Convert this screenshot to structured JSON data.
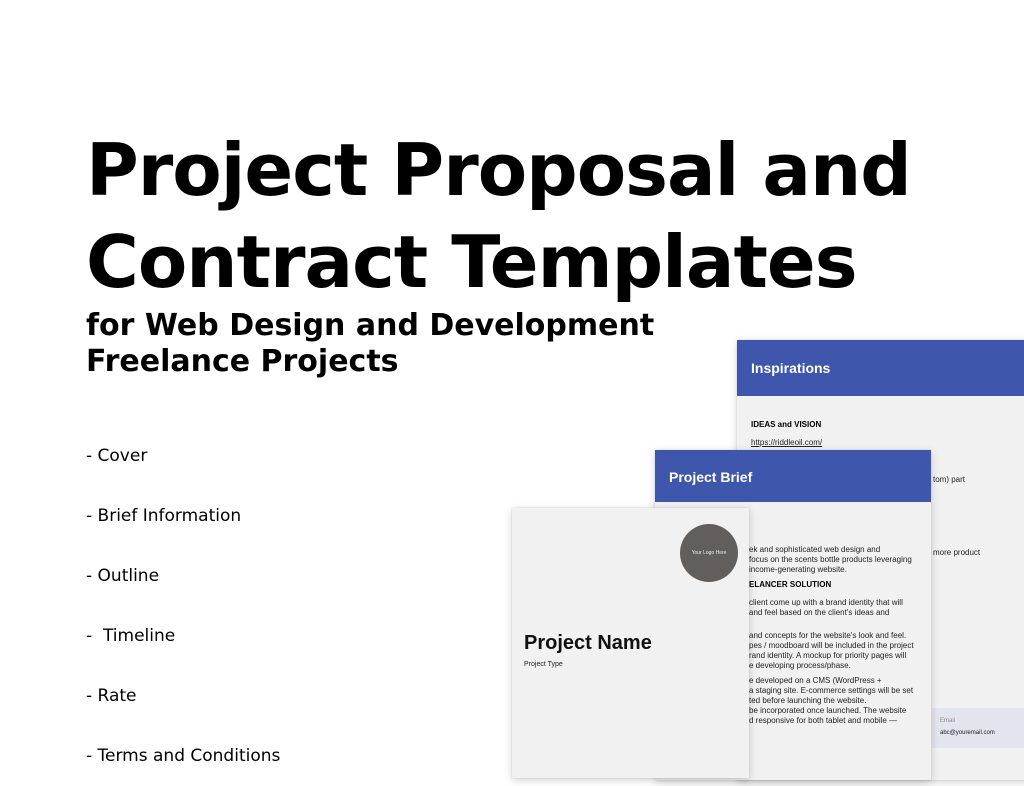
{
  "title": {
    "line1": "Project Proposal and",
    "line2": "Contract Templates"
  },
  "subtitle": {
    "line1": "for Web Design and Development",
    "line2": "Freelance Projects"
  },
  "contents": [
    "- Cover",
    "- Brief Information",
    "- Outline",
    "-  Timeline",
    "- Rate",
    "- Terms and Conditions"
  ],
  "previews": {
    "inspirations": {
      "header": "Inspirations",
      "section": "IDEAS and VISION",
      "link": "https://riddleoil.com/",
      "fragment1": "tom) part",
      "fragment2": "more product",
      "email_label": "Email",
      "email_value": "abc@youremail.com"
    },
    "brief": {
      "header": "Project Brief",
      "lines": [
        "ek and sophisticated web design and",
        "focus on the scents bottle products leveraging",
        "income-generating website."
      ],
      "section": "ELANCER SOLUTION",
      "lines2": [
        "client come up with a brand identity that will",
        "and feel based on the client's ideas and"
      ],
      "lines3": [
        "and concepts for the website's look and feel.",
        "pes / moodboard will be included in the project",
        "rand identity. A mockup for priority pages will",
        "e developing process/phase."
      ],
      "lines4": [
        "e developed on a CMS (WordPress +",
        "a staging site. E-commerce settings will be set",
        "ted before launching the website.",
        "be incorporated once launched. The website",
        "d responsive for both tablet and mobile —"
      ]
    },
    "cover": {
      "logo_text": "Your Logo Here",
      "project_name": "Project Name",
      "project_type": "Project Type"
    }
  },
  "colors": {
    "header_blue": "#3f56ad",
    "logo_circle": "#625e5c"
  }
}
